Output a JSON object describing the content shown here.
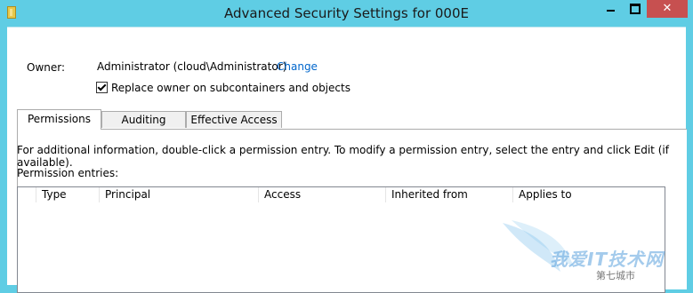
{
  "window": {
    "title": "Advanced Security Settings for 000E",
    "close_glyph": "✕"
  },
  "owner": {
    "label": "Owner:",
    "value": "Administrator (cloud\\Administrator)",
    "change_link": "Change"
  },
  "replace_owner": {
    "label": "Replace owner on subcontainers and objects",
    "checked": true
  },
  "tabs": [
    {
      "label": "Permissions",
      "active": true
    },
    {
      "label": "Auditing",
      "active": false
    },
    {
      "label": "Effective Access",
      "active": false
    }
  ],
  "permissions": {
    "info_text": "For additional information, double-click a permission entry. To modify a permission entry, select the entry and click Edit (if available).",
    "entries_label": "Permission entries:",
    "columns": [
      "Type",
      "Principal",
      "Access",
      "Inherited from",
      "Applies to"
    ]
  },
  "watermark": {
    "text": "我爱IT技术网",
    "sub": "第七城市"
  }
}
